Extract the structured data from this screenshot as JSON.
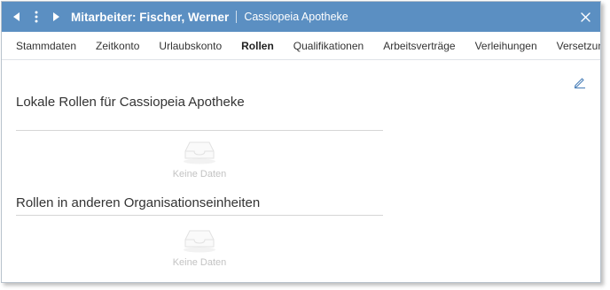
{
  "window": {
    "title": "Mitarbeiter: Fischer, Werner",
    "subtitle": "Cassiopeia Apotheke"
  },
  "tabs": [
    {
      "label": "Stammdaten",
      "active": false
    },
    {
      "label": "Zeitkonto",
      "active": false
    },
    {
      "label": "Urlaubskonto",
      "active": false
    },
    {
      "label": "Rollen",
      "active": true
    },
    {
      "label": "Qualifikationen",
      "active": false
    },
    {
      "label": "Arbeitsverträge",
      "active": false
    },
    {
      "label": "Verleihungen",
      "active": false
    },
    {
      "label": "Versetzungen",
      "active": false
    }
  ],
  "sections": {
    "local": {
      "title": "Lokale Rollen für Cassiopeia Apotheke",
      "empty_text": "Keine Daten"
    },
    "other": {
      "title": "Rollen in anderen Organisationseinheiten",
      "empty_text": "Keine Daten"
    }
  },
  "icons": {
    "back": "triangle-left-icon",
    "menu": "vertical-dots-icon",
    "forward": "triangle-right-icon",
    "close": "close-icon",
    "edit": "pencil-icon",
    "empty": "inbox-tray-icon"
  },
  "colors": {
    "titlebar": "#5b8fc2",
    "accent": "#4a7fb8"
  }
}
